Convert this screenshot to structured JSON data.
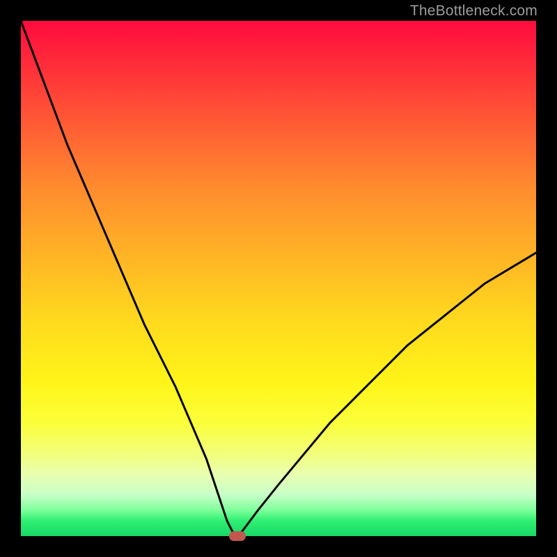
{
  "watermark": "TheBottleneck.com",
  "chart_data": {
    "type": "line",
    "title": "",
    "xlabel": "",
    "ylabel": "",
    "xlim": [
      0,
      100
    ],
    "ylim": [
      0,
      100
    ],
    "series": [
      {
        "name": "bottleneck-curve",
        "x": [
          0,
          3,
          6,
          9,
          12,
          15,
          18,
          21,
          24,
          27,
          30,
          33,
          36,
          38,
          40,
          41,
          42,
          43,
          46,
          50,
          55,
          60,
          65,
          70,
          75,
          80,
          85,
          90,
          95,
          100
        ],
        "values": [
          100,
          92,
          84,
          76,
          69,
          62,
          55,
          48,
          41,
          35,
          29,
          22,
          15,
          9,
          3,
          1,
          0,
          1,
          5,
          10,
          16,
          22,
          27,
          32,
          37,
          41,
          45,
          49,
          52,
          55
        ]
      }
    ],
    "marker": {
      "x": 42,
      "y": 0,
      "color": "#c1574f"
    },
    "gradient_stops": [
      {
        "pos": 0,
        "color": "#ff0a3e"
      },
      {
        "pos": 8,
        "color": "#ff2b3a"
      },
      {
        "pos": 20,
        "color": "#ff5b35"
      },
      {
        "pos": 32,
        "color": "#ff8a2e"
      },
      {
        "pos": 45,
        "color": "#ffb226"
      },
      {
        "pos": 58,
        "color": "#ffd91e"
      },
      {
        "pos": 70,
        "color": "#fff418"
      },
      {
        "pos": 78,
        "color": "#fbff3a"
      },
      {
        "pos": 84,
        "color": "#f2ff7a"
      },
      {
        "pos": 88,
        "color": "#e9ffb0"
      },
      {
        "pos": 92,
        "color": "#c8ffc8"
      },
      {
        "pos": 95,
        "color": "#7dff9a"
      },
      {
        "pos": 97,
        "color": "#2fef73"
      },
      {
        "pos": 100,
        "color": "#17d964"
      }
    ]
  }
}
